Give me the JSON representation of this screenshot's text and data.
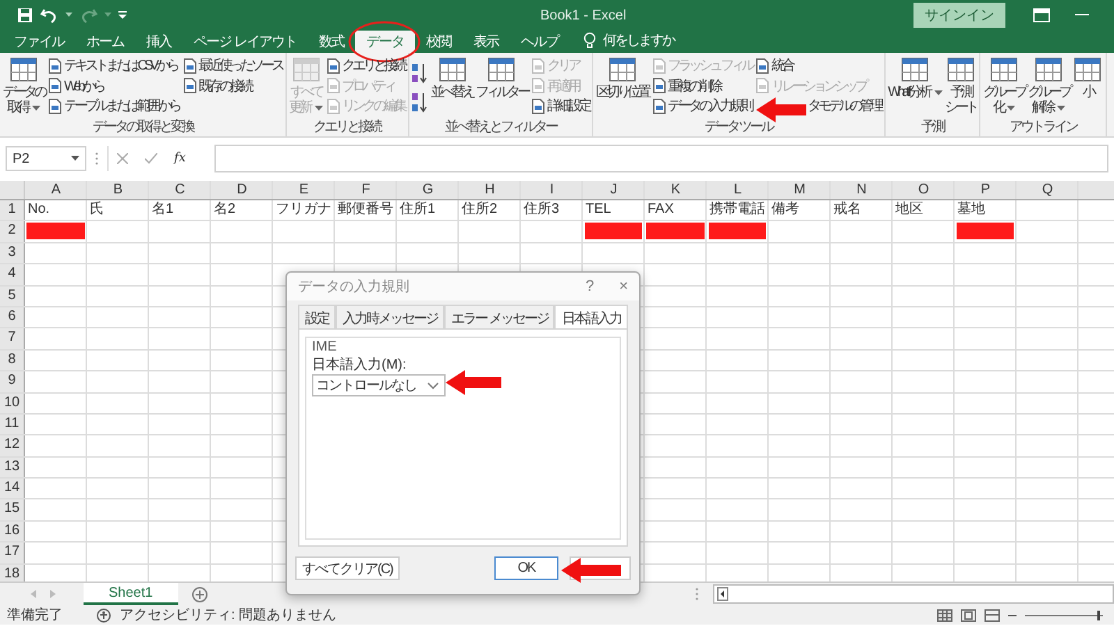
{
  "title_bar": {
    "title": "Book1  -  Excel",
    "sign_in": "サインイン"
  },
  "tabs": [
    {
      "label": "ファイル",
      "selected": false
    },
    {
      "label": "ホーム",
      "selected": false
    },
    {
      "label": "挿入",
      "selected": false
    },
    {
      "label": "ページ レイアウト",
      "selected": false
    },
    {
      "label": "数式",
      "selected": false
    },
    {
      "label": "データ",
      "selected": true
    },
    {
      "label": "校閲",
      "selected": false
    },
    {
      "label": "表示",
      "selected": false
    },
    {
      "label": "ヘルプ",
      "selected": false
    }
  ],
  "tell_me": "何をしますか",
  "ribbon": {
    "groups": [
      {
        "label": "データの取得と変換",
        "items": [
          {
            "kind": "large",
            "lines": [
              "データの",
              "取得"
            ],
            "dropdown": true,
            "disabled": false
          },
          {
            "kind": "column",
            "entries": [
              {
                "kind": "command",
                "text": "テキストまたは CSV から",
                "disabled": false
              },
              {
                "kind": "command",
                "text": "Web から",
                "disabled": false
              },
              {
                "kind": "command",
                "text": "テーブルまたは範囲から",
                "disabled": false
              }
            ]
          },
          {
            "kind": "column",
            "entries": [
              {
                "kind": "command",
                "text": "最近使ったソース",
                "disabled": false
              },
              {
                "kind": "command",
                "text": "既存の接続",
                "disabled": false
              }
            ]
          }
        ]
      },
      {
        "label": "クエリと接続",
        "items": [
          {
            "kind": "large",
            "lines": [
              "すべて",
              "更新"
            ],
            "dropdown": true,
            "disabled": true
          },
          {
            "kind": "column",
            "entries": [
              {
                "kind": "command",
                "text": "クエリと接続",
                "disabled": false
              },
              {
                "kind": "command",
                "text": "プロパティ",
                "disabled": true
              },
              {
                "kind": "command",
                "text": "リンクの編集",
                "disabled": true
              }
            ]
          }
        ]
      },
      {
        "label": "並べ替えとフィルター",
        "items": [
          {
            "kind": "sort"
          },
          {
            "kind": "large",
            "lines": [
              "並べ替え"
            ],
            "dropdown": false,
            "disabled": false
          },
          {
            "kind": "large",
            "lines": [
              "フィルター"
            ],
            "dropdown": false,
            "disabled": false
          },
          {
            "kind": "column",
            "entries": [
              {
                "kind": "command",
                "text": "クリア",
                "disabled": true
              },
              {
                "kind": "command",
                "text": "再適用",
                "disabled": true
              },
              {
                "kind": "command",
                "text": "詳細設定",
                "disabled": false
              }
            ]
          }
        ]
      },
      {
        "label": "データ ツール",
        "items": [
          {
            "kind": "large",
            "lines": [
              "区切り位置"
            ],
            "dropdown": false,
            "disabled": false
          },
          {
            "kind": "column",
            "entries": [
              {
                "kind": "command",
                "text": "フラッシュ フィル",
                "disabled": true
              },
              {
                "kind": "command",
                "text": "重複の削除",
                "disabled": false
              },
              {
                "kind": "command",
                "text": "データの入力規則",
                "disabled": false
              }
            ]
          },
          {
            "kind": "column",
            "entries": [
              {
                "kind": "command",
                "text": "統合",
                "disabled": false
              },
              {
                "kind": "command",
                "text": "リレーションシップ",
                "disabled": true
              },
              {
                "kind": "covered",
                "text": "タ モデルの管理",
                "disabled": false
              }
            ]
          }
        ]
      },
      {
        "label": "予測",
        "items": [
          {
            "kind": "large",
            "lines": [
              "What-If 分析"
            ],
            "dropdown": true,
            "disabled": false
          },
          {
            "kind": "large",
            "lines": [
              "予測",
              "シート"
            ],
            "dropdown": false,
            "disabled": false
          }
        ]
      },
      {
        "label": "アウトライン",
        "items": [
          {
            "kind": "large",
            "lines": [
              "グループ",
              "化"
            ],
            "dropdown": true,
            "disabled": false
          },
          {
            "kind": "large",
            "lines": [
              "グループ",
              "解除"
            ],
            "dropdown": true,
            "disabled": false
          },
          {
            "kind": "large",
            "lines": [
              "小"
            ],
            "dropdown": false,
            "disabled": false
          }
        ]
      }
    ]
  },
  "formula_bar": {
    "name_box": "P2",
    "fx": "fx"
  },
  "grid": {
    "columns": [
      "A",
      "B",
      "C",
      "D",
      "E",
      "F",
      "G",
      "H",
      "I",
      "J",
      "K",
      "L",
      "M",
      "N",
      "O",
      "P",
      "Q"
    ],
    "rows": [
      {
        "header": "1",
        "cells": [
          "No.",
          "氏",
          "名1",
          "名2",
          "フリガナ",
          "郵便番号",
          "住所1",
          "住所2",
          "住所3",
          "TEL",
          "FAX",
          "携帯電話",
          "備考",
          "戒名",
          "地区",
          "墓地"
        ]
      },
      {
        "header": "2",
        "highlighted": [
          true,
          false,
          false,
          false,
          false,
          false,
          false,
          false,
          false,
          true,
          true,
          true,
          false,
          false,
          false,
          true,
          false
        ]
      },
      {
        "header": "3"
      },
      {
        "header": "4"
      },
      {
        "header": "5"
      },
      {
        "header": "6"
      },
      {
        "header": "7"
      },
      {
        "header": "8"
      },
      {
        "header": "9"
      },
      {
        "header": "10"
      },
      {
        "header": "11"
      },
      {
        "header": "12"
      },
      {
        "header": "13"
      },
      {
        "header": "14"
      },
      {
        "header": "15"
      },
      {
        "header": "16"
      },
      {
        "header": "17"
      },
      {
        "header": "18"
      }
    ]
  },
  "dialog": {
    "title": "データの入力規則",
    "help": "?",
    "close": "×",
    "tabs": [
      {
        "label": "設定",
        "selected": false
      },
      {
        "label": "入力時メッセージ",
        "selected": false
      },
      {
        "label": "エラー メッセージ",
        "selected": false
      },
      {
        "label": "日本語入力",
        "selected": true
      }
    ],
    "group": "IME",
    "field_label": "日本語入力(M):",
    "select_value": "コントロールなし",
    "buttons": [
      {
        "label": "すべてクリア(C)",
        "default": false
      },
      {
        "label": "OK",
        "default": true
      }
    ]
  },
  "sheet_tabs": [
    {
      "label": "Sheet1",
      "selected": true
    }
  ],
  "status_bar": {
    "ready": "準備完了",
    "accessibility": "アクセシビリティ: 問題ありません",
    "zoom": {
      "level": 0.92
    }
  }
}
